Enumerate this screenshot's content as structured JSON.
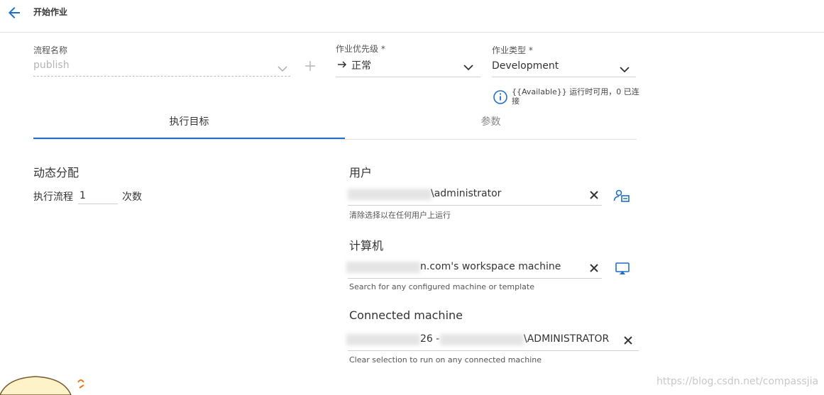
{
  "header": {
    "title": "开始作业"
  },
  "form": {
    "process_name": {
      "label": "流程名称",
      "value": "publish"
    },
    "priority": {
      "label": "作业优先级 *",
      "value": "正常"
    },
    "job_type": {
      "label": "作业类型 *",
      "value": "Development"
    },
    "info": "{{Available}} 运行时可用，0 已连接"
  },
  "tabs": [
    {
      "label": "执行目标"
    },
    {
      "label": "参数"
    }
  ],
  "dynamic": {
    "title": "动态分配",
    "prefix": "执行流程",
    "count": "1",
    "suffix": "次数"
  },
  "user": {
    "title": "用户",
    "value": "\\administrator",
    "hint": "清除选择以在任何用户上运行"
  },
  "machine": {
    "title": "计算机",
    "value": "n.com's workspace machine",
    "hint": "Search for any configured machine or template"
  },
  "connected": {
    "title": "Connected machine",
    "value_part1": "26 -",
    "value_part2": "\\ADMINISTRATOR",
    "hint": "Clear selection to run on any connected machine"
  },
  "watermark": "https://blog.csdn.net/compassjia",
  "colors": {
    "accent": "#1f6fc5"
  }
}
